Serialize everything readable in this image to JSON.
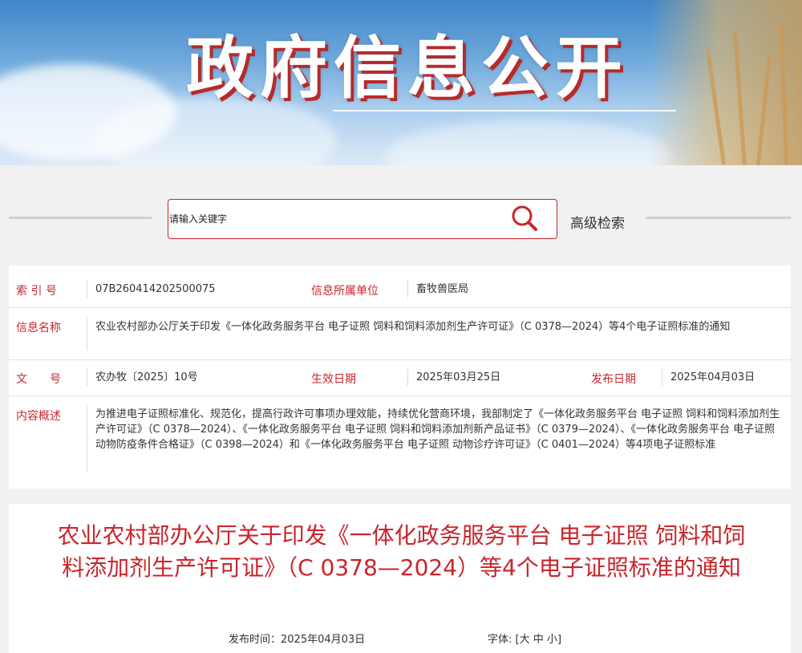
{
  "banner": {
    "title": "政府信息公开"
  },
  "search": {
    "placeholder": "请输入关键字",
    "advanced_label": "高级检索"
  },
  "info": {
    "index_label": "索 引 号",
    "index_value": "07B260414202500075",
    "unit_label": "信息所属单位",
    "unit_value": "畜牧兽医局",
    "name_label": "信息名称",
    "name_value": "农业农村部办公厅关于印发《一体化政务服务平台 电子证照 饲料和饲料添加剂生产许可证》（C 0378—2024）等4个电子证照标准的通知",
    "doc_label": "文　　号",
    "doc_value": "农办牧〔2025〕10号",
    "effective_label": "生效日期",
    "effective_value": "2025年03月25日",
    "publish_label": "发布日期",
    "publish_value": "2025年04月03日",
    "summary_label": "内容概述",
    "summary_value": "为推进电子证照标准化、规范化，提高行政许可事项办理效能，持续优化营商环境，我部制定了《一体化政务服务平台 电子证照 饲料和饲料添加剂生产许可证》（C 0378—2024）、《一体化政务服务平台 电子证照 饲料和饲料添加剂新产品证书》（C 0379—2024）、《一体化政务服务平台 电子证照 动物防疫条件合格证》（C 0398—2024）和《一体化政务服务平台 电子证照 动物诊疗许可证》（C 0401—2024）等4项电子证照标准"
  },
  "article": {
    "title": "农业农村部办公厅关于印发《一体化政务服务平台 电子证照 饲料和饲料添加剂生产许可证》（C 0378—2024）等4个电子证照标准的通知",
    "publish_time_label": "发布时间：",
    "publish_time_value": "2025年04月03日",
    "font_label": "字体:",
    "font_open": "[",
    "font_large": "大",
    "font_medium": "中",
    "font_small": "小",
    "font_close": "]"
  },
  "colors": {
    "accent": "#c9252c",
    "background": "#f1f1f1"
  },
  "icons": {
    "search": "search-icon"
  }
}
